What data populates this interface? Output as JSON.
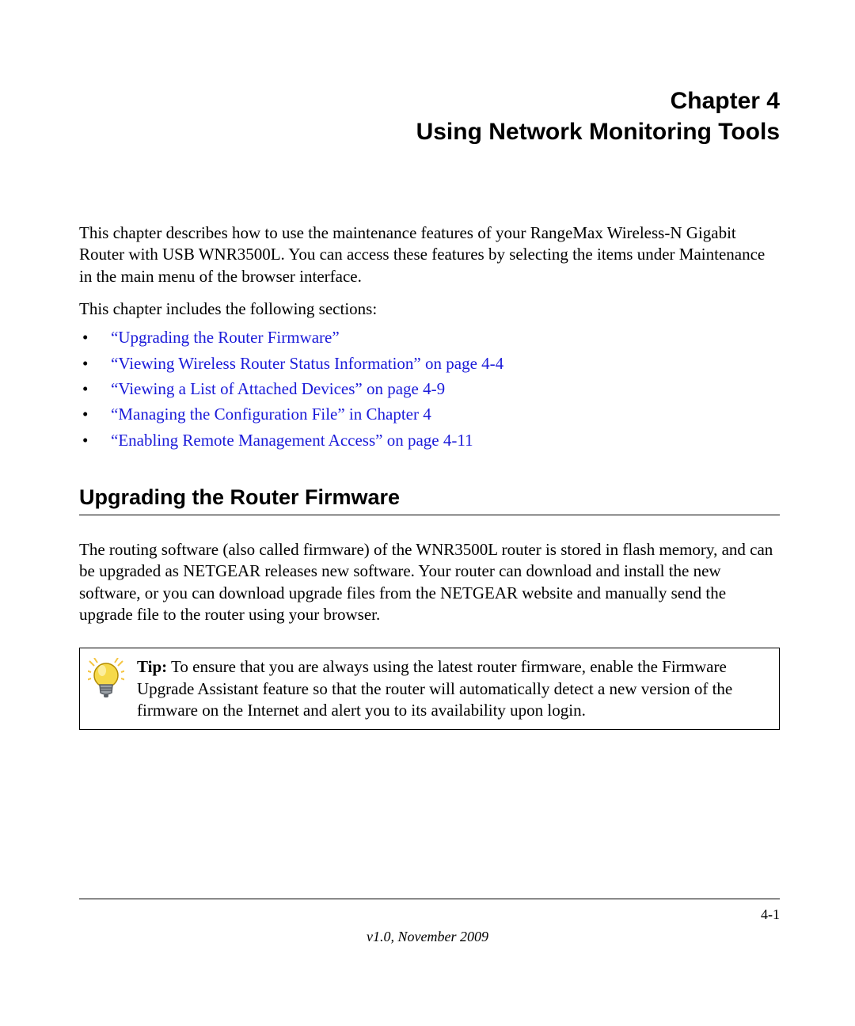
{
  "chapter": {
    "number_label": "Chapter 4",
    "title": "Using Network Monitoring Tools"
  },
  "intro": "This chapter describes how to use the maintenance features of your RangeMax Wireless-N Gigabit Router with USB WNR3500L. You can access these features by selecting the items under Maintenance in the main menu of the browser interface.",
  "sections_intro": "This chapter includes the following sections:",
  "section_links": [
    "“Upgrading the Router Firmware”",
    "“Viewing Wireless Router Status Information” on page 4-4",
    "“Viewing a List of Attached Devices” on page 4-9",
    "“Managing the Configuration File” in Chapter 4",
    "“Enabling Remote Management Access” on page 4-11"
  ],
  "section1": {
    "heading": "Upgrading the Router Firmware",
    "body": "The routing software (also called firmware) of the WNR3500L router is stored in flash memory, and can be upgraded as NETGEAR releases new software. Your router can download and install the new software, or you can download upgrade files from the NETGEAR website and manually send the upgrade file to the router using your browser."
  },
  "tip": {
    "label": "Tip:",
    "text": " To ensure that you are always using the latest router firmware, enable the Firmware Upgrade Assistant feature so that the router will automatically detect a new version of the firmware on the Internet and alert you to its availability upon login."
  },
  "footer": {
    "page": "4-1",
    "version": "v1.0, November 2009"
  }
}
